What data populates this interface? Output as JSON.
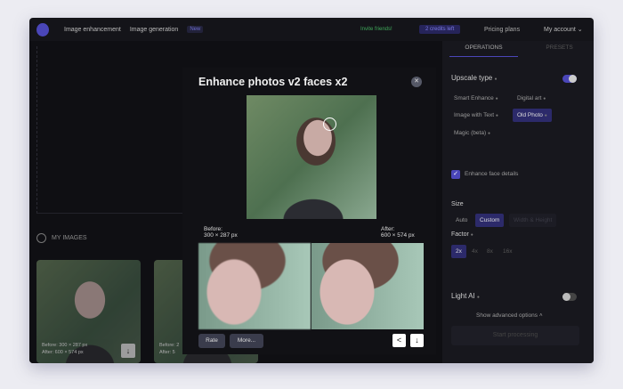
{
  "topbar": {
    "nav_enhance": "Image enhancement",
    "nav_generation": "Image generation",
    "new_badge": "New",
    "invite": "Invite friends!",
    "credits": "2 credits left",
    "pricing": "Pricing plans",
    "account": "My account"
  },
  "gallery": {
    "title": "MY IMAGES",
    "card1": {
      "before": "Before:  300 × 287 px",
      "after": "After:    600 × 574 px"
    },
    "card2": {
      "before": "Before: 2",
      "after": "After:   5"
    }
  },
  "modal": {
    "title": "Enhance photos v2 faces x2",
    "before_label": "Before:",
    "before_size": "300 × 287 px",
    "after_label": "After:",
    "after_size": "600 × 574 px",
    "rate": "Rate",
    "more": "More..."
  },
  "panel": {
    "tabs": [
      "OPERATIONS",
      "PRESETS"
    ],
    "upscale_type": "Upscale type",
    "upscale_on": true,
    "options": [
      "Smart Enhance",
      "Digital art",
      "Image with Text",
      "Old Photo",
      "Magic (beta)"
    ],
    "selected_option": "Old Photo",
    "face_details": "Enhance face details",
    "face_details_checked": true,
    "size_label": "Size",
    "size_options": [
      "Auto",
      "Custom",
      "Width & Height"
    ],
    "selected_size": "Custom",
    "factor_label": "Factor",
    "factors": [
      "2x",
      "4x",
      "8x",
      "16x"
    ],
    "selected_factor": "2x",
    "light_ai": "Light AI",
    "light_ai_on": false,
    "advanced": "Show advanced options",
    "start": "Start processing"
  },
  "colors": {
    "accent": "#4a46b8",
    "bg": "#141419"
  }
}
